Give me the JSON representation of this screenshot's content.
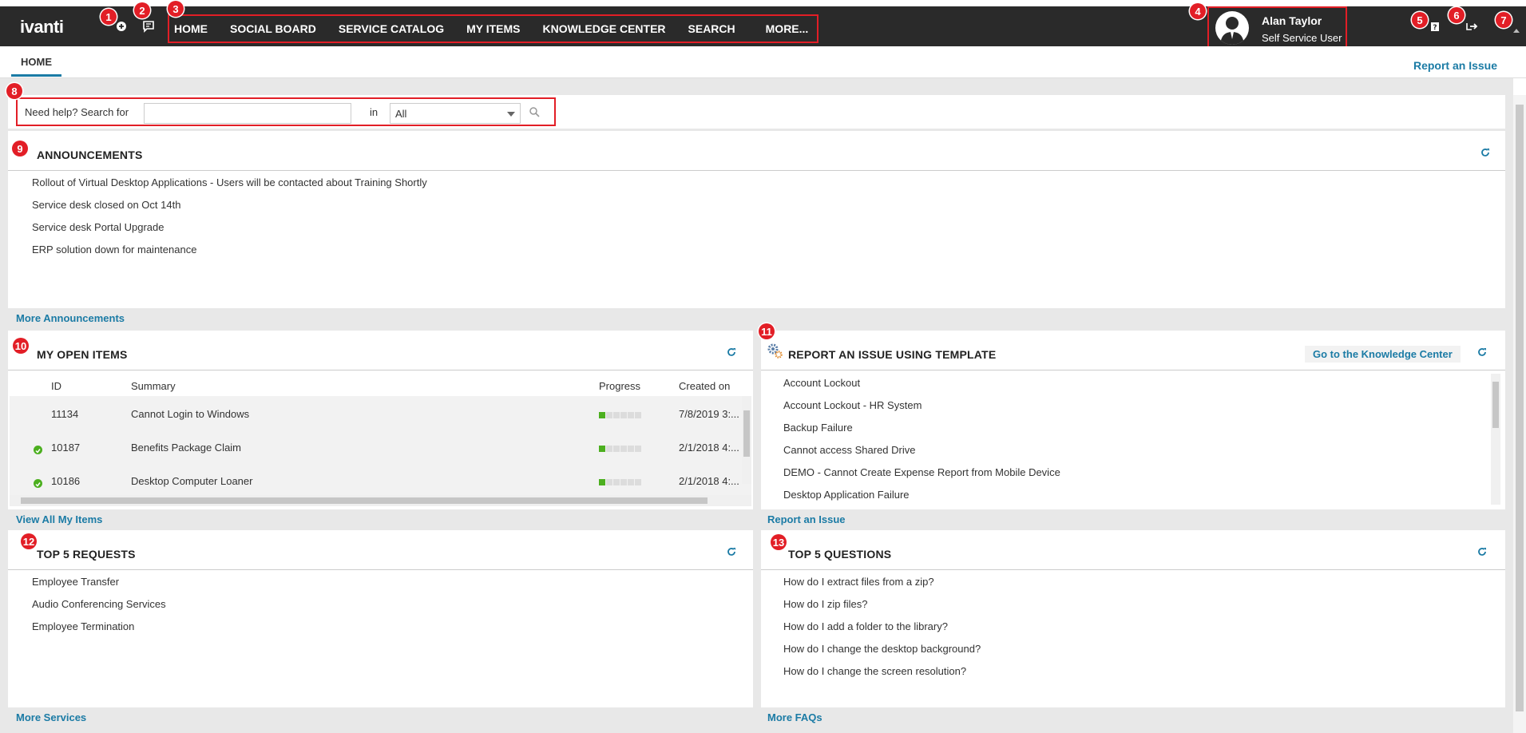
{
  "app": {
    "logo_text": "ivanti"
  },
  "nav": {
    "items": [
      "HOME",
      "SOCIAL BOARD",
      "SERVICE CATALOG",
      "MY ITEMS",
      "KNOWLEDGE CENTER",
      "SEARCH",
      "MORE..."
    ]
  },
  "user": {
    "name": "Alan Taylor",
    "role": "Self Service User"
  },
  "badges": [
    "1",
    "2",
    "3",
    "4",
    "5",
    "6",
    "7",
    "8",
    "9",
    "10",
    "11",
    "12",
    "13"
  ],
  "tabs": {
    "home": "HOME",
    "report_link": "Report an Issue"
  },
  "search": {
    "label": "Need help? Search for",
    "value": "",
    "in_label": "in",
    "scope": "All"
  },
  "announcements": {
    "title": "ANNOUNCEMENTS",
    "items": [
      "Rollout of Virtual Desktop Applications - Users will be contacted about Training Shortly",
      "Service desk closed on Oct 14th",
      "Service desk Portal Upgrade",
      "ERP solution down for maintenance"
    ],
    "footer": "More Announcements"
  },
  "open_items": {
    "title": "MY OPEN ITEMS",
    "columns": [
      "ID",
      "Summary",
      "Progress",
      "Created on"
    ],
    "rows": [
      {
        "id": "11134",
        "summary": "Cannot Login to Windows",
        "created": "7/8/2019 3:...",
        "done": false,
        "progress": 0.2
      },
      {
        "id": "10187",
        "summary": "Benefits Package Claim",
        "created": "2/1/2018 4:...",
        "done": true,
        "progress": 0.2
      },
      {
        "id": "10186",
        "summary": "Desktop Computer Loaner",
        "created": "2/1/2018 4:...",
        "done": true,
        "progress": 0.2
      }
    ],
    "footer": "View All My Items"
  },
  "report_template": {
    "title": "REPORT AN ISSUE USING TEMPLATE",
    "kc_button": "Go to the Knowledge Center",
    "items": [
      "Account Lockout",
      "Account Lockout - HR System",
      "Backup Failure",
      "Cannot access Shared Drive",
      "DEMO - Cannot Create Expense Report from Mobile Device",
      "Desktop Application Failure"
    ],
    "footer": "Report an Issue"
  },
  "top_requests": {
    "title": "TOP 5 REQUESTS",
    "items": [
      "Employee Transfer",
      "Audio Conferencing Services",
      "Employee Termination"
    ],
    "footer": "More Services"
  },
  "top_questions": {
    "title": "TOP 5 QUESTIONS",
    "items": [
      "How do I extract files from a zip?",
      "How do I zip files?",
      "How do I add a folder to the library?",
      "How do I change the desktop background?",
      "How do I change the screen resolution?"
    ],
    "footer": "More FAQs"
  },
  "colors": {
    "accent": "#1b7ba5",
    "brand_red": "#e21e26",
    "topbar": "#2a2a2a",
    "progress": "#4caf1f"
  }
}
